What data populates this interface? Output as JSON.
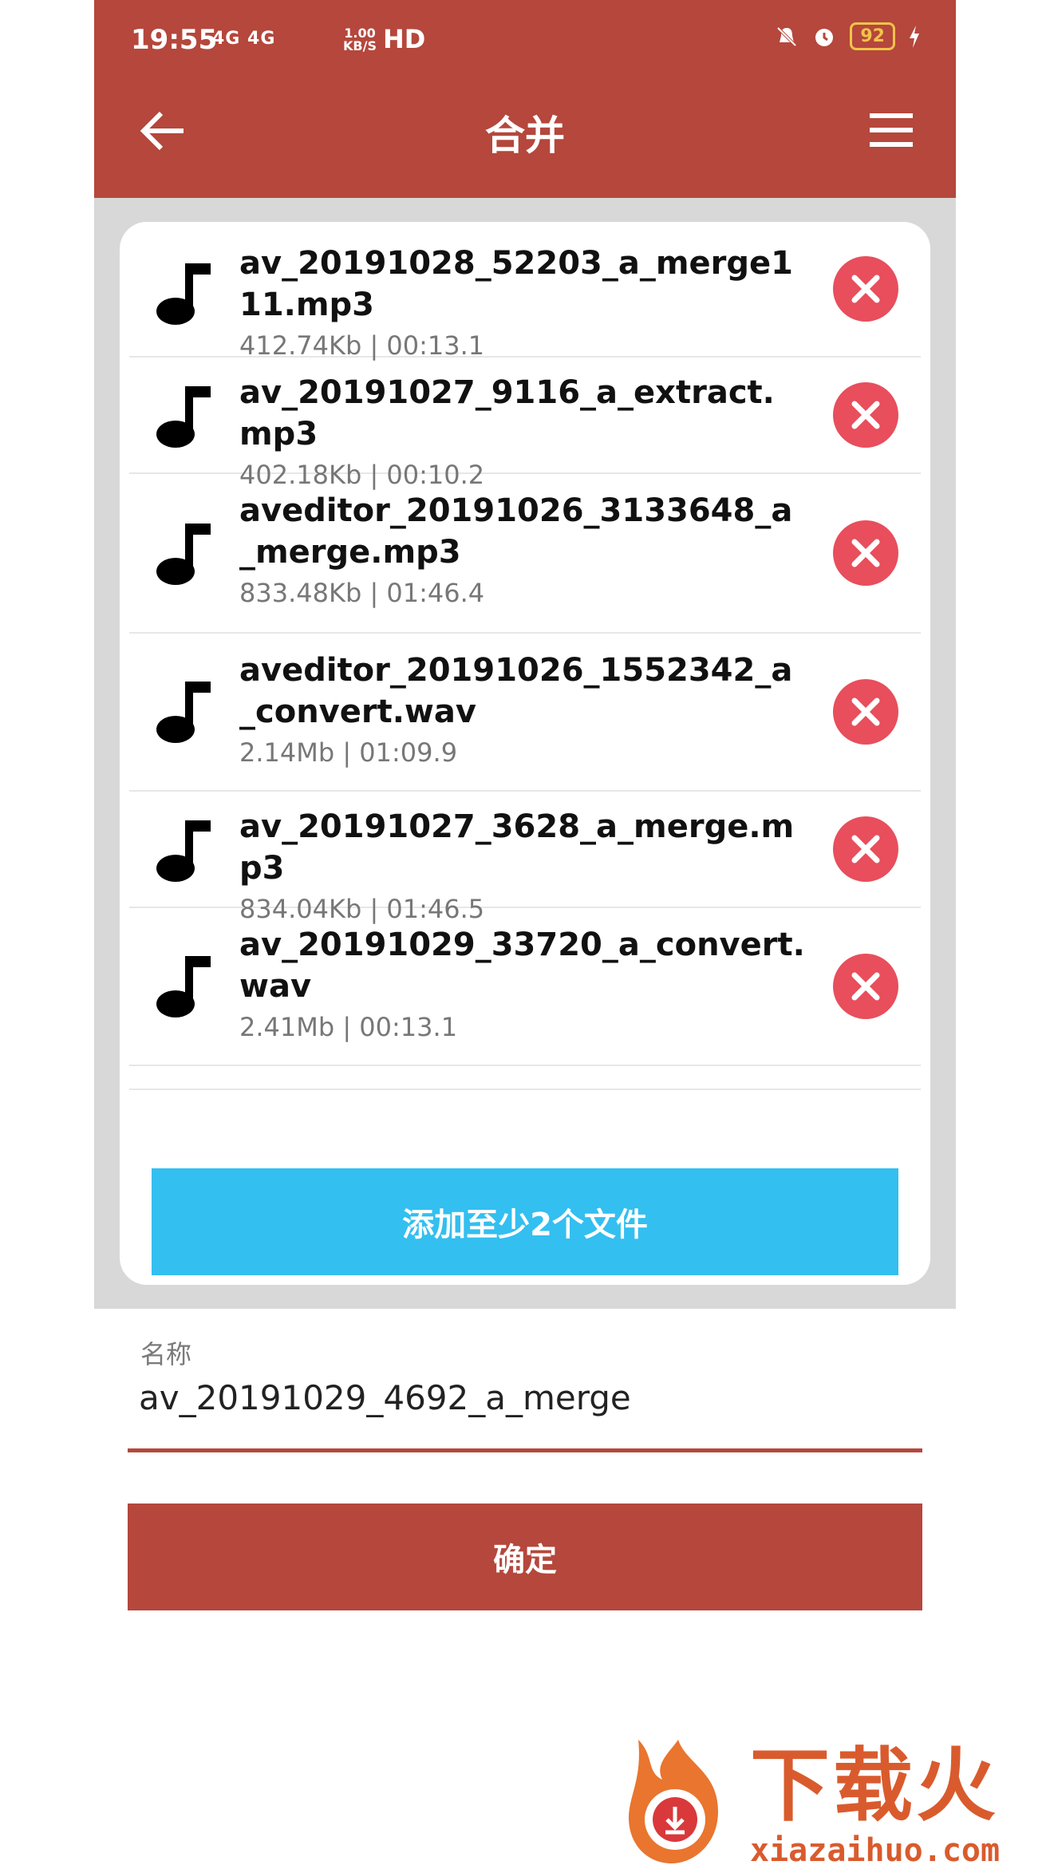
{
  "status": {
    "time": "19:55",
    "network": "4G 4G",
    "speed": "1.00\nKB/S",
    "hd": "HD",
    "battery": "92"
  },
  "appbar": {
    "title": "合并"
  },
  "files": [
    {
      "name": "av_20191028_52203_a_merge111.mp3",
      "size": "412.74Kb",
      "duration": "00:13.1"
    },
    {
      "name": "av_20191027_9116_a_extract.mp3",
      "size": "402.18Kb",
      "duration": "00:10.2"
    },
    {
      "name": "aveditor_20191026_3133648_a_merge.mp3",
      "size": "833.48Kb",
      "duration": "01:46.4"
    },
    {
      "name": "aveditor_20191026_1552342_a_convert.wav",
      "size": "2.14Mb",
      "duration": "01:09.9"
    },
    {
      "name": "av_20191027_3628_a_merge.mp3",
      "size": "834.04Kb",
      "duration": "01:46.5"
    },
    {
      "name": "av_20191029_33720_a_convert.wav",
      "size": "2.41Mb",
      "duration": "00:13.1"
    }
  ],
  "add_button": "添加至少2个文件",
  "name_field": {
    "label": "名称",
    "value": "av_20191029_4692_a_merge"
  },
  "confirm_button": "确定",
  "watermark": {
    "text": "下载火",
    "url": "xiazaihuo.com"
  },
  "colors": {
    "primary": "#b5473c",
    "accent": "#33bff0",
    "delete": "#e84e5c"
  }
}
